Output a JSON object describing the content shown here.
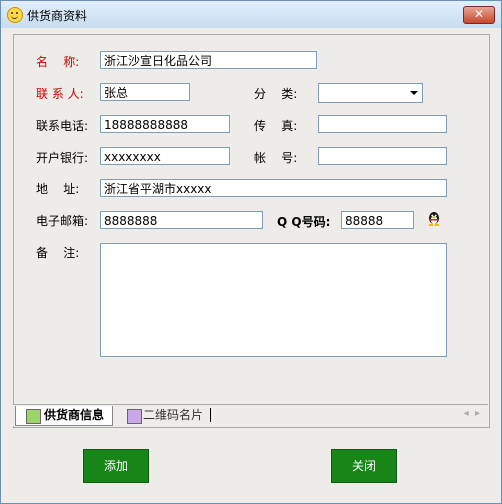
{
  "window": {
    "title": "供货商资料",
    "close_label": "✕"
  },
  "form": {
    "name_label": "名    称:",
    "name_value": "浙江沙宣日化品公司",
    "contact_label": "联 系 人:",
    "contact_value": "张总",
    "category_label": "分    类:",
    "category_value": "",
    "phone_label": "联系电话:",
    "phone_value": "18888888888",
    "fax_label": "传    真:",
    "fax_value": "",
    "bank_label": "开户银行:",
    "bank_value": "xxxxxxxx",
    "account_label": "帐    号:",
    "account_value": "",
    "address_label": "地    址:",
    "address_value": "浙江省平湖市xxxxx",
    "email_label": "电子邮箱:",
    "email_value": "8888888",
    "qq_label": "Q Q号码:",
    "qq_value": "88888",
    "notes_label": "备    注:",
    "notes_value": ""
  },
  "tabs": [
    {
      "label": "供货商信息",
      "color": "#9ad46a",
      "active": true
    },
    {
      "label": "二维码名片",
      "color": "#c7a8e8",
      "active": false
    }
  ],
  "buttons": {
    "add_label": "添加",
    "close_label": "关闭"
  },
  "colors": {
    "required_label": "#d00000",
    "button_green": "#178518"
  }
}
